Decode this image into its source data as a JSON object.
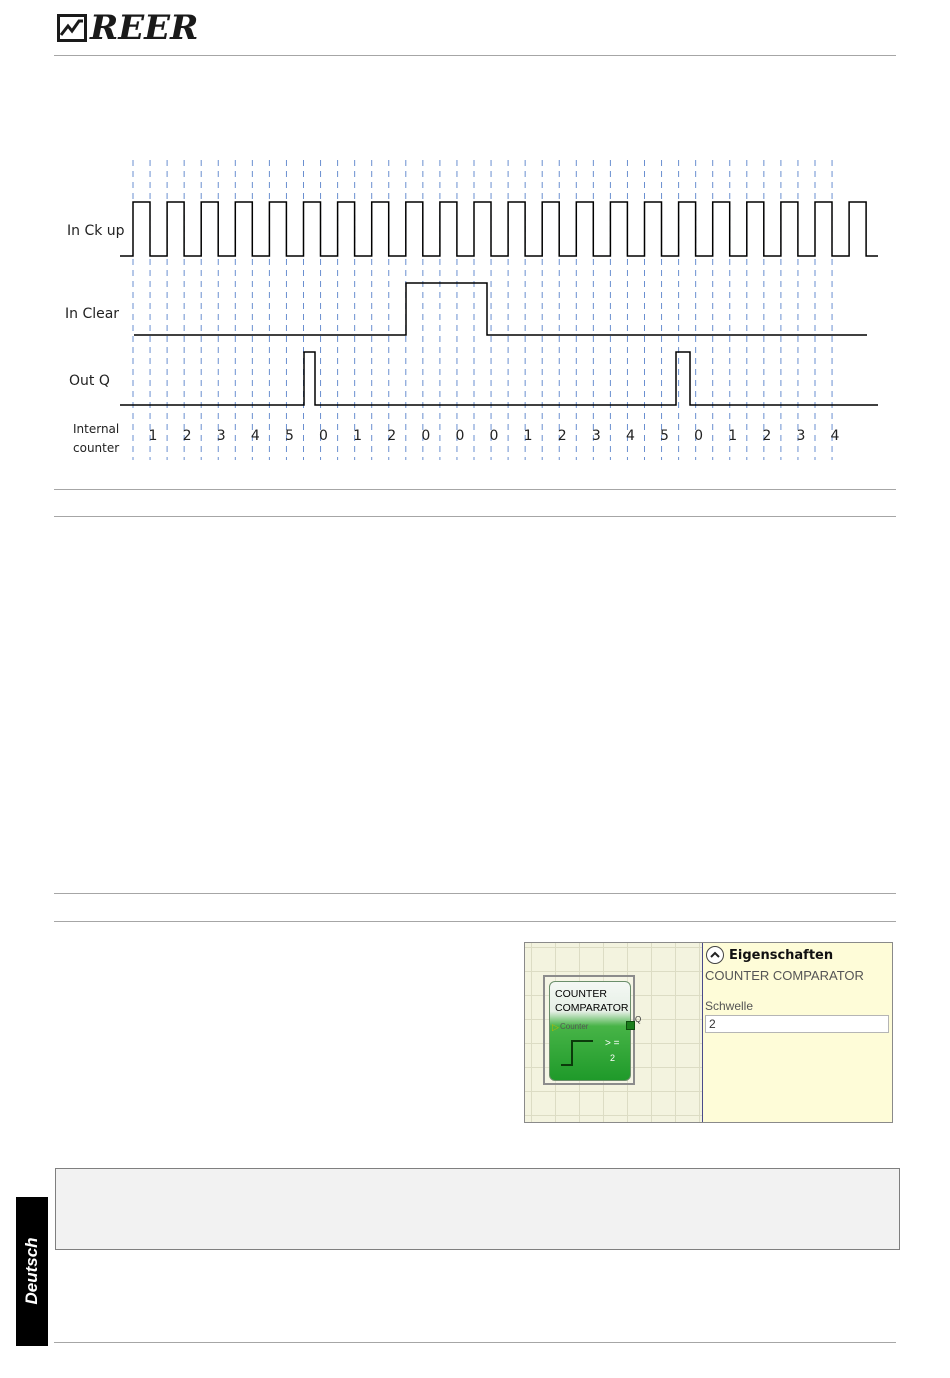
{
  "header": {
    "logo_text": "REER"
  },
  "timing_diagram": {
    "signals": [
      {
        "label": "In Ck up"
      },
      {
        "label": "In Clear"
      },
      {
        "label": "Out Q"
      }
    ],
    "counter_label_line1": "Internal",
    "counter_label_line2": "counter",
    "counter_values": [
      "1",
      "2",
      "3",
      "4",
      "5",
      "0",
      "1",
      "2",
      "0",
      "0",
      "0",
      "1",
      "2",
      "3",
      "4",
      "5",
      "0",
      "1",
      "2",
      "3",
      "4"
    ]
  },
  "block": {
    "title_line1": "COUNTER",
    "title_line2": "COMPARATOR",
    "input_label": "Counter",
    "output_label": "Q",
    "operator": "> =",
    "threshold": "2"
  },
  "properties": {
    "title": "Eigenschaften",
    "subtitle": "COUNTER COMPARATOR",
    "field_label": "Schwelle",
    "field_value": "2"
  },
  "side_tab": {
    "label": "Deutsch"
  },
  "colors": {
    "block_green": "#1f9a2a",
    "props_bg": "#fefcd8",
    "grid_bg": "#f3f3df",
    "guide_blue": "#6a8fd0"
  }
}
